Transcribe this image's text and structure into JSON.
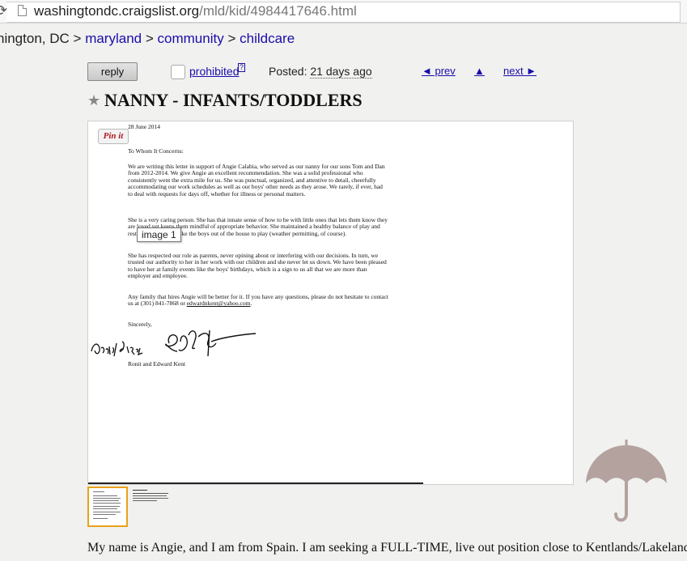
{
  "browser": {
    "url_host": "washingtondc.craigslist.org",
    "url_path": "/mld/kid/4984417646.html"
  },
  "breadcrumbs": {
    "city": "hington, DC",
    "separator": ">",
    "area": "maryland",
    "section": "community",
    "category": "childcare"
  },
  "post": {
    "reply_label": "reply",
    "flag_label": "prohibited",
    "flag_help": "?",
    "posted_label": "Posted:",
    "posted_ago": "21 days ago",
    "prev_label": "◄ prev",
    "up_label": "▲",
    "next_label": "next ►",
    "star_icon": "★",
    "title": "NANNY - INFANTS/TODDLERS"
  },
  "viewer": {
    "pinit_label": "Pin it",
    "tooltip": "image 1",
    "letter": {
      "date": "28 June 2014",
      "salutation": "To Whom It Concerns:",
      "paragraph1": "We are writing this letter in support of Angie Calabia, who served as our nanny for our sons Tom and Dan from 2012-2014.  We give Angie an excellent recommendation.  She was a solid professional who consistently went the extra mile for us.  She was punctual, organized, and attentive to detail, cheerfully accommodating our work schedules as well as our boys' other needs as they arose.  We rarely, if ever, had to deal with requests for days off, whether for illness or personal matters.",
      "paragraph2": "She is a very caring person.  She has that innate sense of how to be with little ones that lets them know they are loved yet keeps them mindful of appropriate behavior.  She maintained a healthy balance of play and rest, making sure to take the boys out of the house to play (weather permitting, of course).",
      "paragraph3": "She has respected our role as parents, never opining about or interfering with our decisions.  In turn, we trusted our authority to her in her work with our children and she never let us down.  We have been pleased to have her at family events like the boys' birthdays, which is a sign to us all that we are more than employer and employee.",
      "paragraph4_start": "Any family that hires Angie will be better for it.  If you have any questions, please do not hesitate to contact us at (301) 841-7868 or ",
      "email": "edwardnkent@yahoo.com",
      "paragraph4_end": ".",
      "closing": "Sincerely,",
      "names": "Ronit and Edward Kent"
    }
  },
  "body_text": "My name is Angie, and I am from Spain. I am seeking a FULL-TIME, live out position close to Kentlands/Lakeland",
  "colors": {
    "link": "#1a0dab",
    "thumb_selected": "#e8a21a",
    "umbrella": "#b3a29e"
  },
  "icons": [
    "reload-icon",
    "page-icon",
    "star-icon",
    "umbrella-icon",
    "signature"
  ]
}
